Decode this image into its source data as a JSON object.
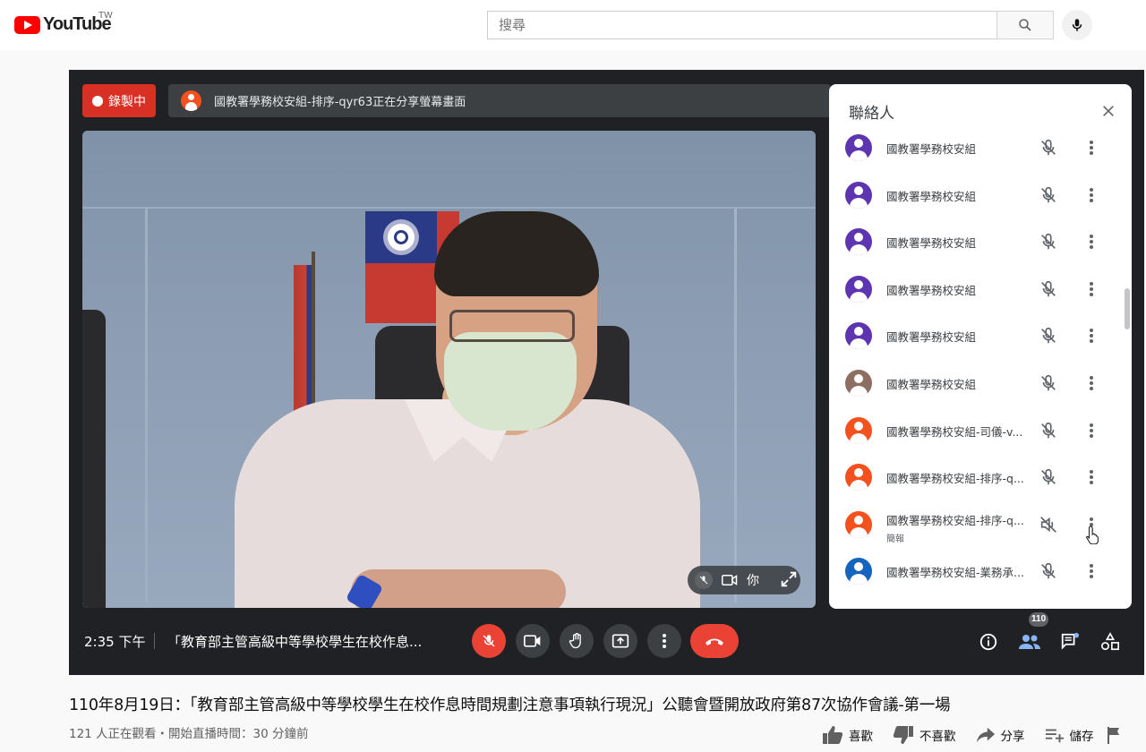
{
  "youtube": {
    "brand": "YouTube",
    "region": "TW",
    "search_placeholder": "搜尋"
  },
  "meet": {
    "recording_label": "錄製中",
    "share_banner": "國教署學務校安組-排序-qyr63正在分享螢幕畫面",
    "self_label": "你",
    "panel_title": "聯絡人",
    "participants": [
      {
        "name": "國教署學務校安組",
        "avatar_color": "#5e35b1"
      },
      {
        "name": "國教署學務校安組",
        "avatar_color": "#5e35b1"
      },
      {
        "name": "國教署學務校安組",
        "avatar_color": "#5e35b1"
      },
      {
        "name": "國教署學務校安組",
        "avatar_color": "#5e35b1"
      },
      {
        "name": "國教署學務校安組",
        "avatar_color": "#5e35b1"
      },
      {
        "name": "國教署學務校安組",
        "avatar_color": "#8d6e63"
      },
      {
        "name": "國教署學務校安組-司儀-v...",
        "avatar_color": "#f4511e"
      },
      {
        "name": "國教署學務校安組-排序-q...",
        "avatar_color": "#f4511e"
      },
      {
        "name": "國教署學務校安組-排序-q...",
        "sub": "簡報",
        "avatar_color": "#f4511e"
      },
      {
        "name": "國教署學務校安組-業務承...",
        "avatar_color": "#1565c0"
      }
    ],
    "time": "2:35 下午",
    "meeting_name": "「教育部主管高級中等學校學生在校作息...",
    "participant_count": "110",
    "colors": {
      "end_call": "#ea4335",
      "muted": "#ea4335",
      "people_accent": "#8ab4f8"
    }
  },
  "video": {
    "title": "110年8月19日：「教育部主管高級中等學校學生在校作息時間規劃注意事項執行現況」公聽會暨開放政府第87次協作會議-第一場",
    "meta": "121 人正在觀看・開始直播時間：30 分鐘前",
    "actions": {
      "like": "喜歡",
      "dislike": "不喜歡",
      "share": "分享",
      "save": "儲存"
    }
  }
}
